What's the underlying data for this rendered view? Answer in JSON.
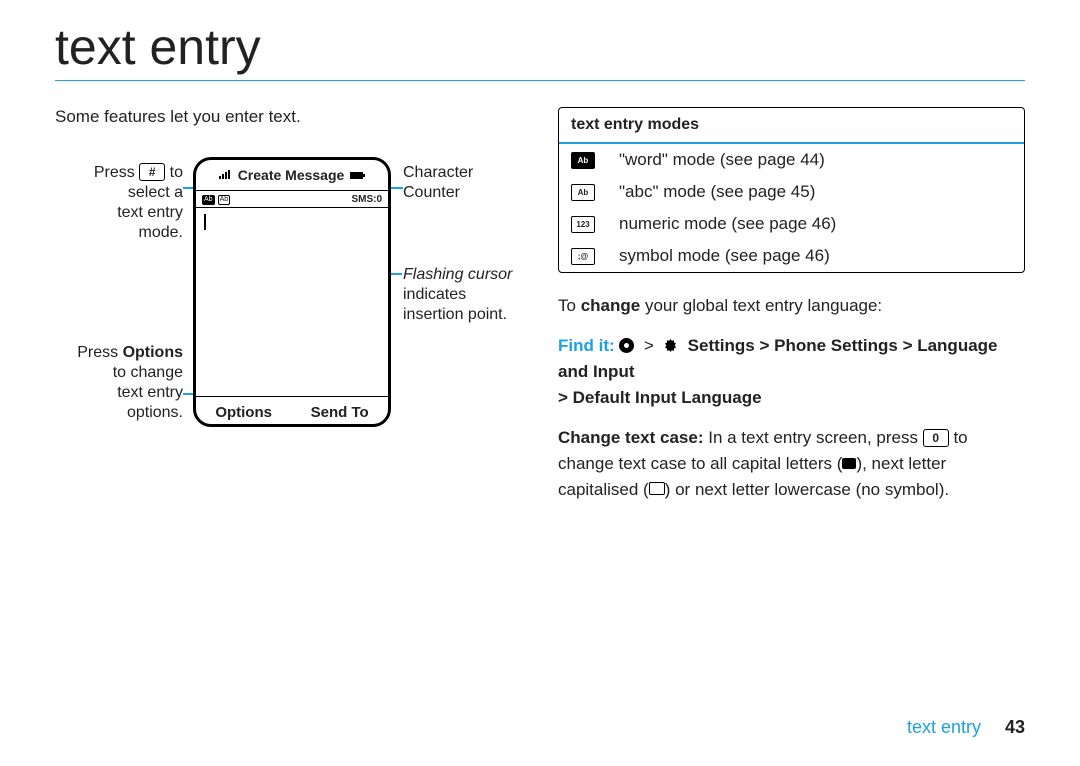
{
  "page_title": "text entry",
  "intro": "Some features let you enter text.",
  "callouts": {
    "c1_line1": "Press ",
    "c1_key": "#",
    "c1_line1b": " to",
    "c1_line2": "select a",
    "c1_line3": "text entry",
    "c1_line4": "mode.",
    "c2_line1": "Press ",
    "c2_bold": "Options",
    "c2_line2": "to change",
    "c2_line3": "text entry",
    "c2_line4": "options.",
    "c3_line1": "Character",
    "c3_line2": "Counter",
    "c4_italic": "Flashing cursor",
    "c4_line2": "indicates",
    "c4_line3": "insertion point."
  },
  "phone": {
    "title": "Create Message",
    "sms": "SMS:0",
    "soft_left": "Options",
    "soft_right": "Send To"
  },
  "modes": {
    "header": "text entry modes",
    "rows": [
      {
        "icon": "Ab",
        "filled": true,
        "text": "\"word\" mode (see page 44)"
      },
      {
        "icon": "Ab",
        "filled": false,
        "text": "\"abc\" mode (see page 45)"
      },
      {
        "icon": "123",
        "filled": false,
        "text": "numeric mode (see page 46)"
      },
      {
        "icon": ";@",
        "filled": false,
        "text": "symbol mode (see page 46)"
      }
    ]
  },
  "change_lang": {
    "lead": "To ",
    "bold": "change",
    "rest": " your global text entry language:"
  },
  "find_it": {
    "label": "Find it:",
    "path1": "Settings > Phone Settings > Language and Input",
    "path2": "> Default Input Language"
  },
  "change_case": {
    "bold": "Change text case:",
    "t1": " In a text entry screen, press ",
    "key": "0",
    "t2": " to change text case to all capital letters (",
    "t3": "), next letter capitalised (",
    "t4": ") or next letter lowercase (no symbol)."
  },
  "footer": {
    "section": "text entry",
    "page": "43"
  }
}
